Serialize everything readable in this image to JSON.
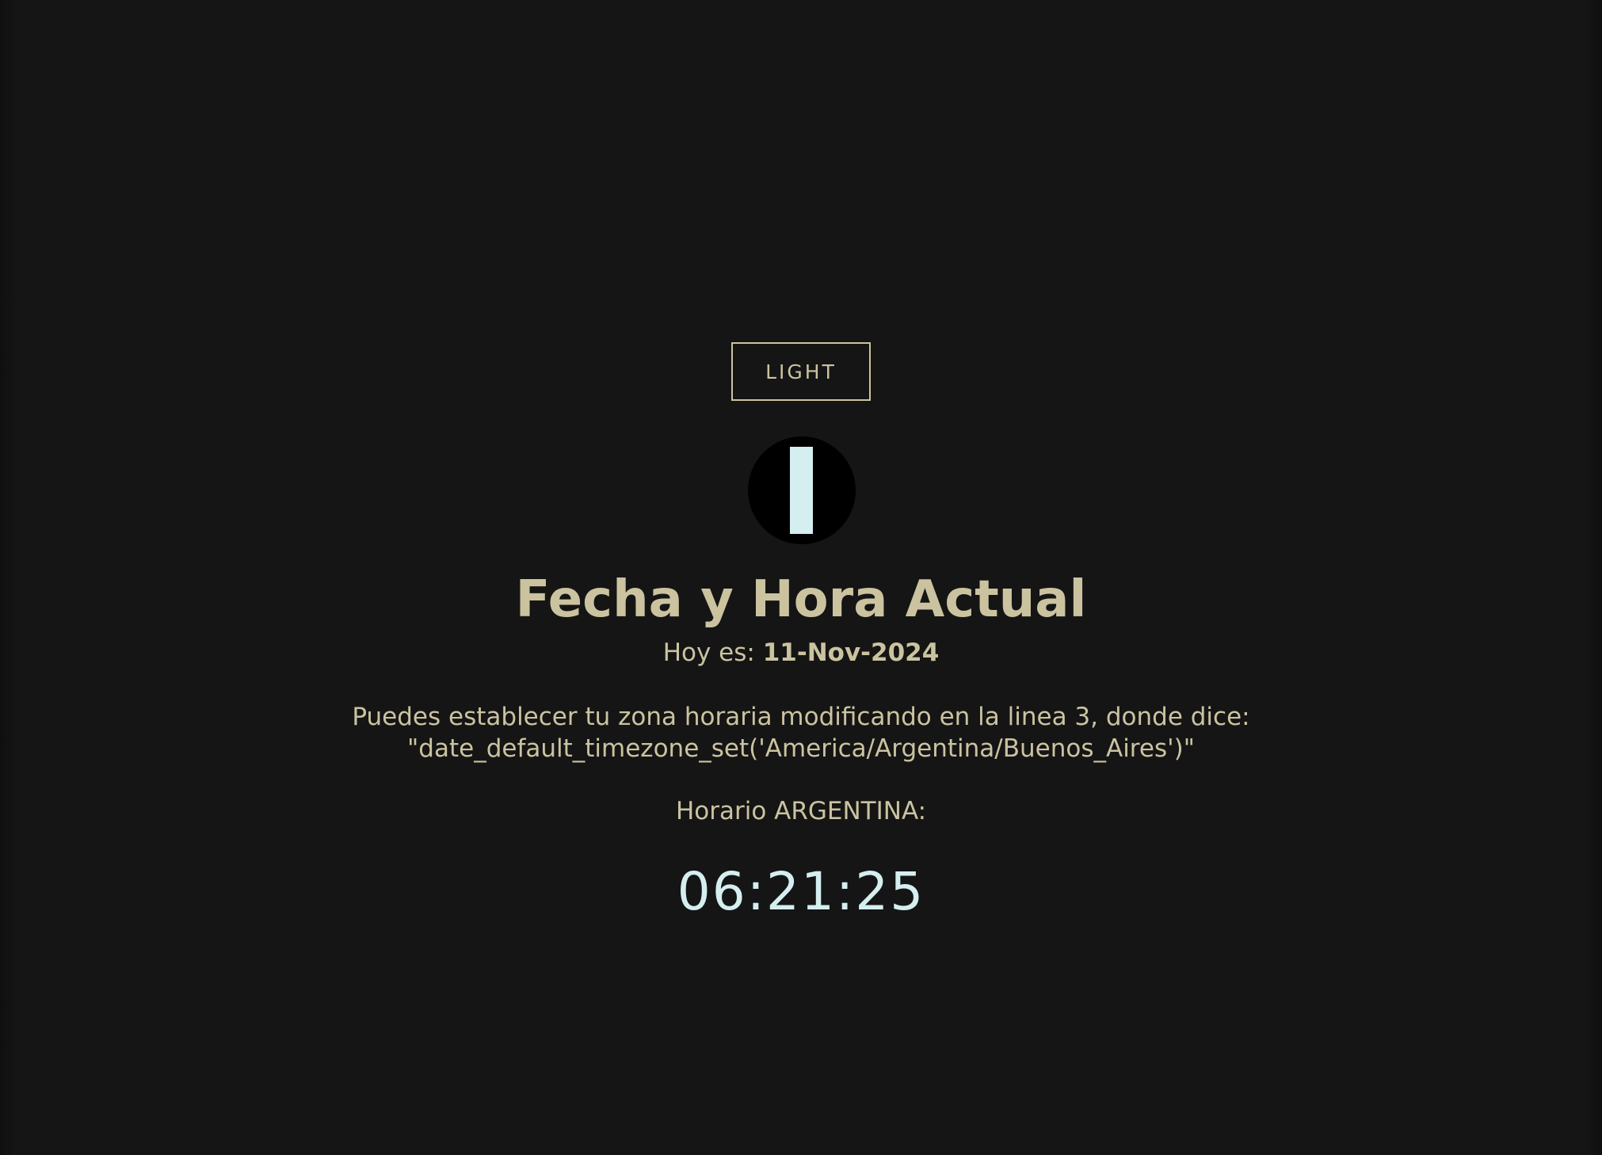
{
  "theme_toggle": {
    "label": "LIGHT"
  },
  "clock_icon": {
    "icon": "clock-icon"
  },
  "header": {
    "title": "Fecha y Hora Actual"
  },
  "today": {
    "prefix": "Hoy es:",
    "date": "11-Nov-2024"
  },
  "timezone_info": {
    "line1": "Puedes establecer tu zona horaria modificando en la linea 3, donde dice:",
    "line2": "\"date_default_timezone_set('America/Argentina/Buenos_Aires')\""
  },
  "schedule": {
    "label": "Horario ARGENTINA:",
    "time": "06:21:25"
  },
  "colors": {
    "background": "#151515",
    "text": "#cbc3a0",
    "accent": "#d5eef0"
  }
}
